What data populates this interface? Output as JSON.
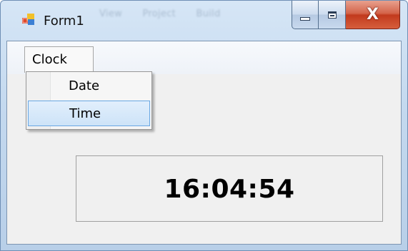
{
  "window": {
    "title": "Form1",
    "icon": "form-app-icon",
    "caption_buttons": [
      {
        "name": "minimize",
        "icon": "minimize-icon"
      },
      {
        "name": "maximize",
        "icon": "maximize-icon"
      },
      {
        "name": "close",
        "icon": "close-icon"
      }
    ]
  },
  "background_window_text": [
    "View",
    "Project",
    "Build"
  ],
  "menubar": {
    "items": [
      {
        "label": "Clock",
        "expanded": true
      }
    ]
  },
  "dropdown": {
    "items": [
      {
        "label": "Date",
        "highlighted": false
      },
      {
        "label": "Time",
        "highlighted": true
      }
    ]
  },
  "display": {
    "time": "16:04:54"
  },
  "colors": {
    "highlight_border": "#68a7e3",
    "highlight_fill": "#cde3f8",
    "close_button": "#c23a1d",
    "client_background": "#f0f0f0"
  }
}
